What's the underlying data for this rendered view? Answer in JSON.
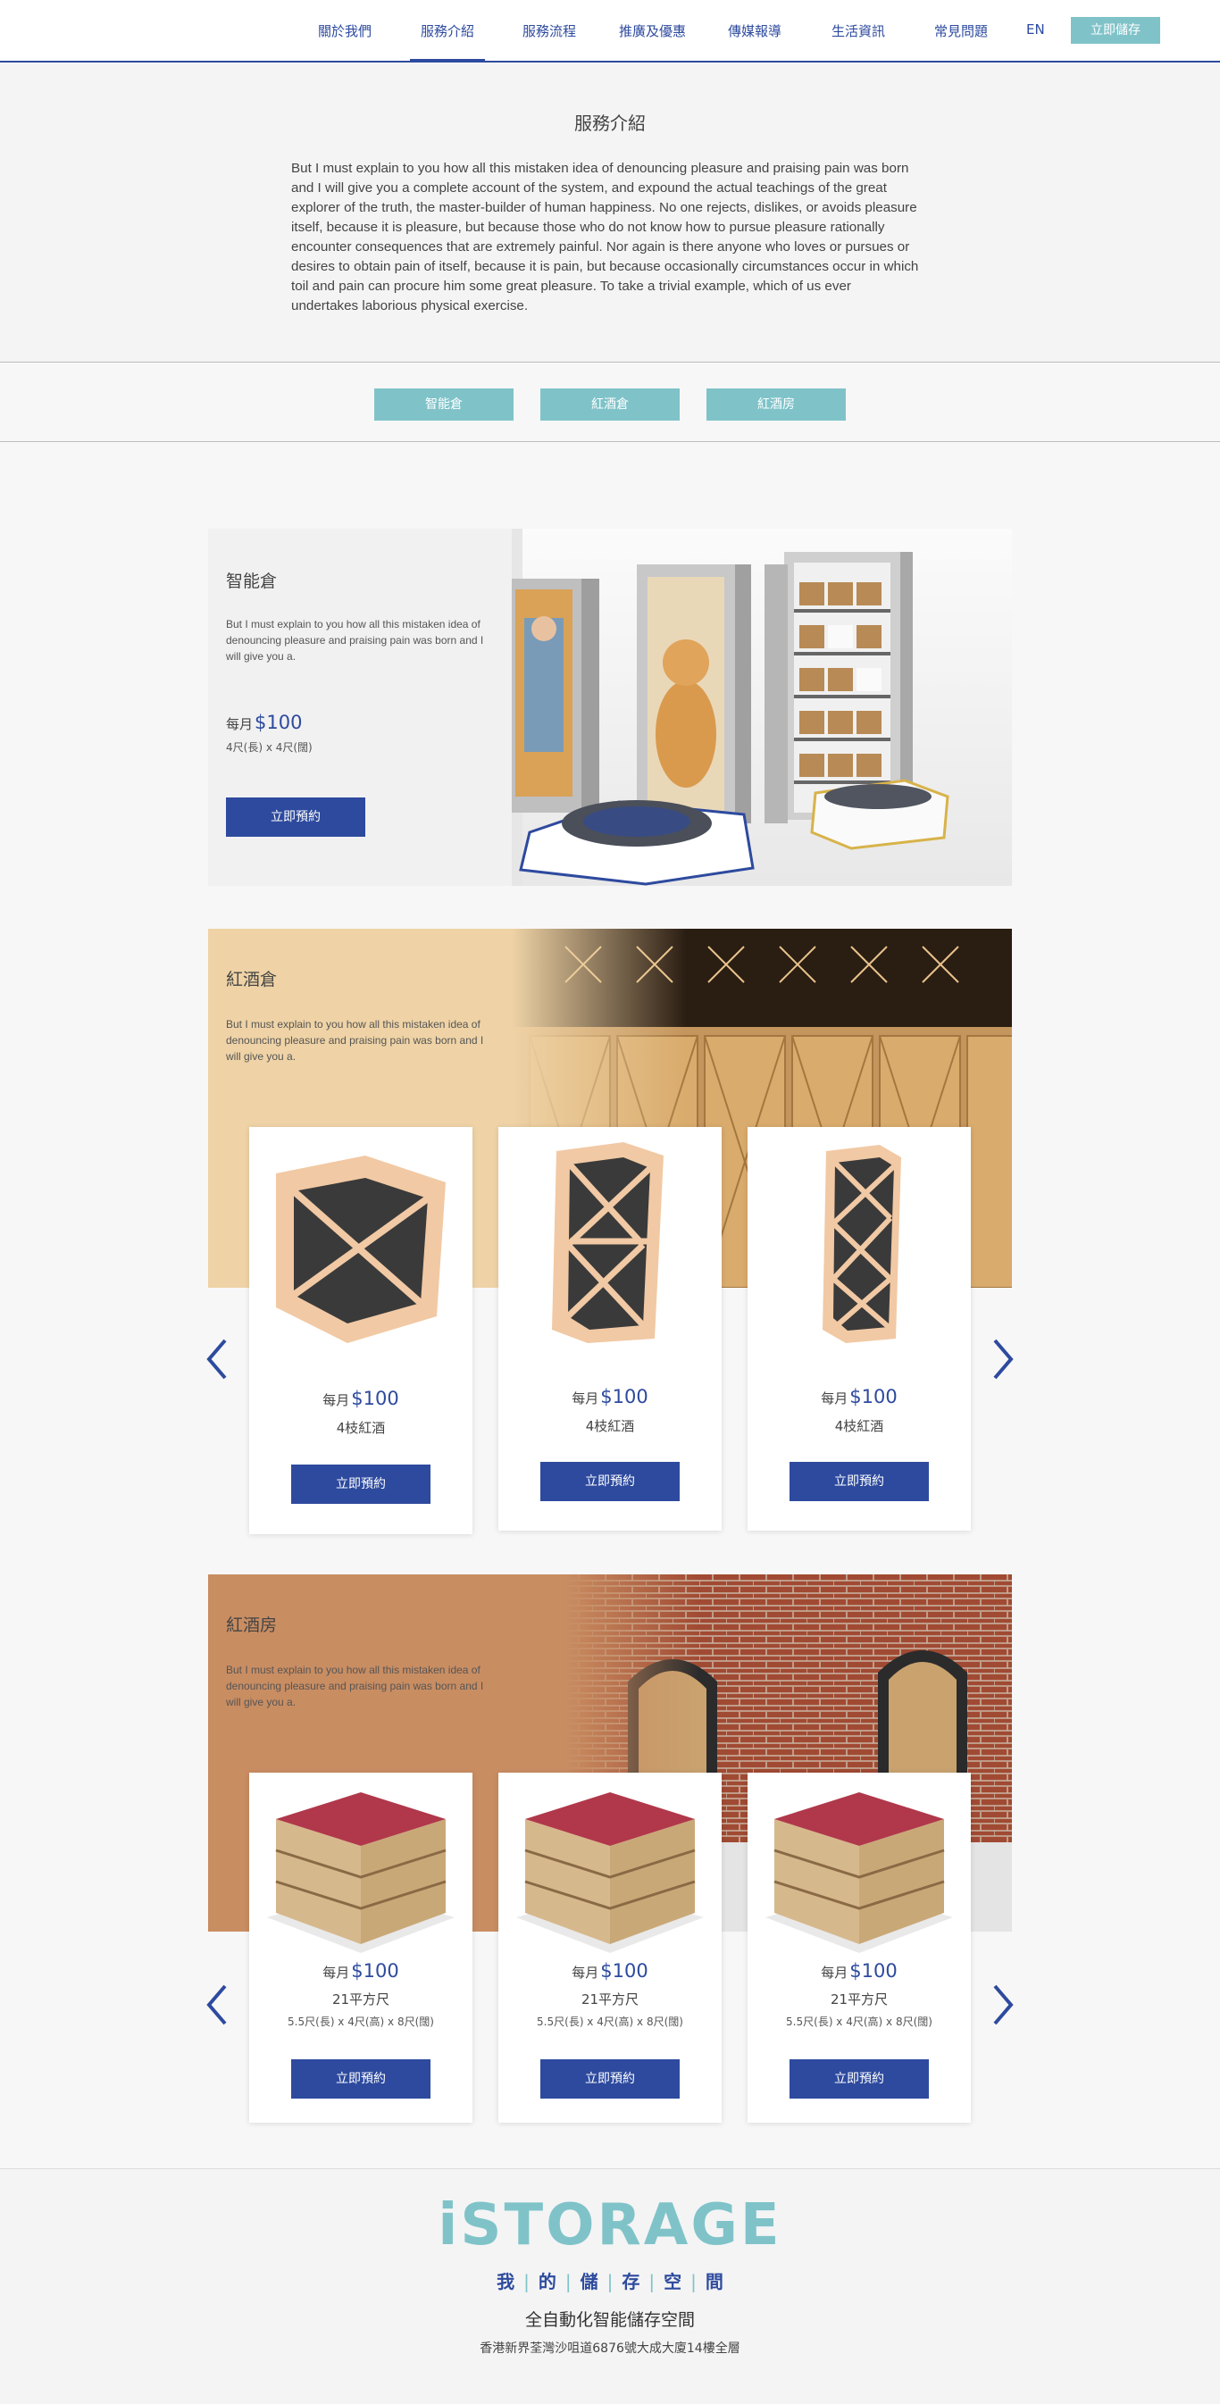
{
  "nav": {
    "items": [
      "關於我們",
      "服務介紹",
      "服務流程",
      "推廣及優惠",
      "傳媒報導",
      "生活資訊",
      "常見問題",
      "EN"
    ],
    "cta": "立即儲存"
  },
  "intro": {
    "title": "服務介紹",
    "text": "But I must explain to you how all this mistaken idea of denouncing pleasure and praising pain was born and I will give you a complete account of the system, and expound the actual teachings of the great explorer of the truth, the master-builder of human happiness. No one rejects, dislikes, or avoids pleasure itself, because it is pleasure, but because those who do not know how to pursue pleasure rationally encounter consequences that are extremely painful. Nor again is there anyone who loves or pursues or desires to obtain pain of itself, because it is pain, but because occasionally circumstances occur in which toil and pain can procure him some great pleasure. To take a trivial example, which of us ever undertakes laborious physical exercise."
  },
  "tabs": [
    "智能倉",
    "紅酒倉",
    "紅酒房"
  ],
  "smart_storage": {
    "title": "智能倉",
    "desc": "But I must explain to you how all this mistaken idea of denouncing pleasure and praising pain was born and I will give you a.",
    "price_prefix": "每月",
    "price": "$100",
    "size": "4尺(長) x 4尺(闊)",
    "button": "立即預約"
  },
  "wine_storage": {
    "title": "紅酒倉",
    "desc": "But I must explain to you how all this mistaken idea of denouncing pleasure and praising pain was born and I will give you a.",
    "products": [
      {
        "price_prefix": "每月",
        "price": "$100",
        "sub": "4枝紅酒",
        "button": "立即預約"
      },
      {
        "price_prefix": "每月",
        "price": "$100",
        "sub": "4枝紅酒",
        "button": "立即預約"
      },
      {
        "price_prefix": "每月",
        "price": "$100",
        "sub": "4枝紅酒",
        "button": "立即預約"
      }
    ]
  },
  "wine_room": {
    "title": "紅酒房",
    "desc": "But I must explain to you how all this mistaken idea of denouncing pleasure and praising pain was born and I will give you a.",
    "products": [
      {
        "price_prefix": "每月",
        "price": "$100",
        "sub": "21平方尺",
        "dim": "5.5尺(長) x 4尺(高) x 8尺(闊)",
        "button": "立即預約"
      },
      {
        "price_prefix": "每月",
        "price": "$100",
        "sub": "21平方尺",
        "dim": "5.5尺(長) x 4尺(高) x 8尺(闊)",
        "button": "立即預約"
      },
      {
        "price_prefix": "每月",
        "price": "$100",
        "sub": "21平方尺",
        "dim": "5.5尺(長) x 4尺(高) x 8尺(闊)",
        "button": "立即預約"
      }
    ]
  },
  "footer": {
    "logo": "iSTORAGE",
    "slogan": [
      "我",
      "的",
      "儲",
      "存",
      "空",
      "間"
    ],
    "tagline": "全自動化智能儲存空間",
    "address": "香港新界荃灣沙咀道6876號大成大廈14樓全層"
  },
  "colors": {
    "brand_blue": "#2d4a9e",
    "teal": "#7fc3c9",
    "wine_bg": "#efd3a6",
    "room_bg": "#c98d62"
  },
  "icons": {
    "prev": "chevron-left-icon",
    "next": "chevron-right-icon"
  }
}
